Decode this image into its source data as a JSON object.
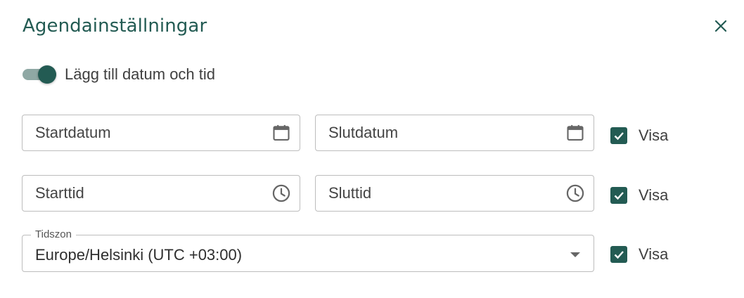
{
  "dialog": {
    "title": "Agendainställningar",
    "accent_color": "#235b53",
    "close_icon": "close-icon"
  },
  "toggle": {
    "label": "Lägg till datum och tid",
    "on": true
  },
  "fields": {
    "start_date": {
      "placeholder": "Startdatum",
      "icon": "calendar-icon"
    },
    "end_date": {
      "placeholder": "Slutdatum",
      "icon": "calendar-icon"
    },
    "start_time": {
      "placeholder": "Starttid",
      "icon": "clock-icon"
    },
    "end_time": {
      "placeholder": "Sluttid",
      "icon": "clock-icon"
    }
  },
  "timezone": {
    "label": "Tidszon",
    "value": "Europe/Helsinki (UTC +03:00)",
    "icon": "dropdown-arrow-icon"
  },
  "show_checkboxes": [
    {
      "label": "Visa",
      "checked": true
    },
    {
      "label": "Visa",
      "checked": true
    },
    {
      "label": "Visa",
      "checked": true
    }
  ]
}
